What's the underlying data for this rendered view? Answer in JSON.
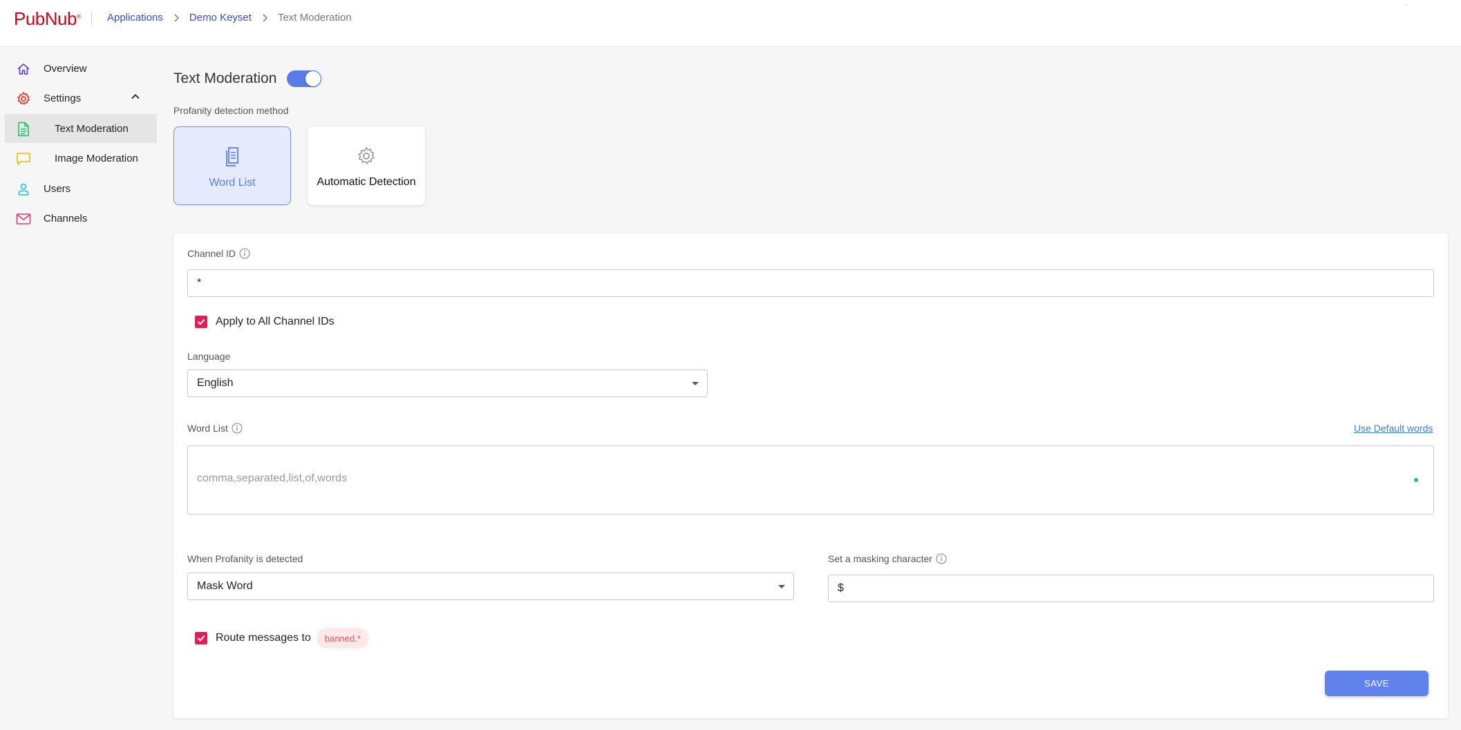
{
  "header": {
    "logo_text": "PubNub",
    "logo_mark": "®",
    "breadcrumb": [
      {
        "label": "Applications"
      },
      {
        "label": "Demo Keyset"
      },
      {
        "label": "Text Moderation"
      }
    ]
  },
  "sidebar": {
    "items": [
      {
        "label": "Overview",
        "icon": "home-icon",
        "color": "#6a3fc9"
      },
      {
        "label": "Settings",
        "icon": "gear-icon",
        "color": "#e1322d",
        "expanded": true
      },
      {
        "label": "Text Moderation",
        "icon": "document-icon",
        "color": "#1fbf6a",
        "active": true
      },
      {
        "label": "Image Moderation",
        "icon": "chat-bubble-icon",
        "color": "#f2b800"
      },
      {
        "label": "Users",
        "icon": "user-icon",
        "color": "#19c2e0"
      },
      {
        "label": "Channels",
        "icon": "mail-icon",
        "color": "#e0396f"
      }
    ]
  },
  "main": {
    "title": "Text Moderation",
    "toggle_on": true,
    "method_label": "Profanity detection method",
    "methods": [
      {
        "label": "Word List",
        "icon": "copy-documents-icon",
        "selected": true
      },
      {
        "label": "Automatic Detection",
        "icon": "gear-icon",
        "selected": false
      }
    ],
    "form": {
      "channel_id_label": "Channel ID",
      "channel_id_value": "*",
      "apply_all_label": "Apply to All Channel IDs",
      "apply_all_checked": true,
      "language_label": "Language",
      "language_value": "English",
      "word_list_label": "Word List",
      "use_default_link": "Use Default words",
      "word_list_placeholder": "comma,separated,list,of,words",
      "profanity_action_label": "When Profanity is detected",
      "profanity_action_value": "Mask Word",
      "masking_char_label": "Set a masking character",
      "masking_char_value": "$",
      "route_label": "Route messages to",
      "route_checked": true,
      "route_chip": "banned.*",
      "save_label": "SAVE"
    }
  },
  "colors": {
    "brand": "#d0021b",
    "accent": "#5a7bea",
    "checkbox": "#e01e5a",
    "link": "#3a4cc0"
  }
}
